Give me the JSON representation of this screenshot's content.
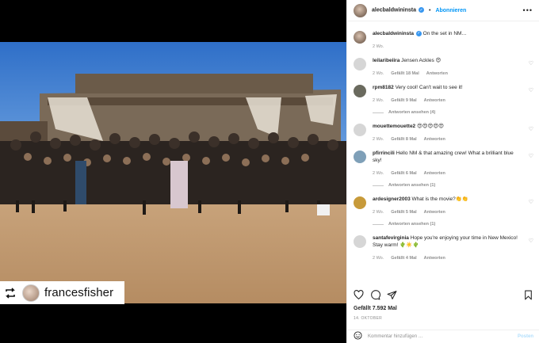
{
  "post": {
    "username": "alecbaldwininsta",
    "follow_label": "Abonnieren",
    "dot": "•",
    "caption": "On the set in NM…",
    "caption_time": "2 Wo.",
    "repost_name": "francesfisher"
  },
  "comments": [
    {
      "user": "leilaribeiira",
      "text": "Jensen Ackles 😍",
      "time": "2 Wo.",
      "likes": "Gefällt 18 Mal",
      "reply": "Antworten",
      "view_replies": "",
      "avatar_color": "#d6d6d6"
    },
    {
      "user": "rpm8182",
      "text": "Very cool! Can't wait to see it!",
      "time": "2 Wo.",
      "likes": "Gefällt 9 Mal",
      "reply": "Antworten",
      "view_replies": "Antworten ansehen (4)",
      "avatar_color": "#6a6a5e"
    },
    {
      "user": "mouettemouette2",
      "text": "😍😍😍😍😍",
      "time": "2 Wo.",
      "likes": "Gefällt 8 Mal",
      "reply": "Antworten",
      "view_replies": "",
      "avatar_color": "#d6d6d6"
    },
    {
      "user": "pfirrincili",
      "text": "Hello NM & that amazing crew! What a brilliant blue sky!",
      "time": "2 Wo.",
      "likes": "Gefällt 6 Mal",
      "reply": "Antworten",
      "view_replies": "Antworten ansehen (1)",
      "avatar_color": "#7fa0b8"
    },
    {
      "user": "ardesigner2003",
      "text": "What is the movie?👏👏",
      "time": "2 Wo.",
      "likes": "Gefällt 5 Mal",
      "reply": "Antworten",
      "view_replies": "Antworten ansehen (1)",
      "avatar_color": "#c79a3a"
    },
    {
      "user": "santafevirginia",
      "text": "Hope you're enjoying your time in New Mexico! Stay warm! 🌵☀️🌵",
      "time": "2 Wo.",
      "likes": "Gefällt 4 Mal",
      "reply": "Antworten",
      "view_replies": "",
      "avatar_color": "#d6d6d6"
    }
  ],
  "footer": {
    "likes": "Gefällt 7.592 Mal",
    "date": "14. OKTOBER",
    "comment_placeholder": "Kommentar hinzufügen …",
    "post_label": "Posten"
  },
  "icons": [
    "repost-icon",
    "verified-icon",
    "more-icon",
    "heart-icon",
    "comment-icon",
    "share-icon",
    "bookmark-icon",
    "emoji-icon"
  ],
  "colors": {
    "accent": "#0095f6",
    "verified": "#3897f0",
    "muted": "#8e8e8e",
    "sky": "#3f7fd1"
  }
}
